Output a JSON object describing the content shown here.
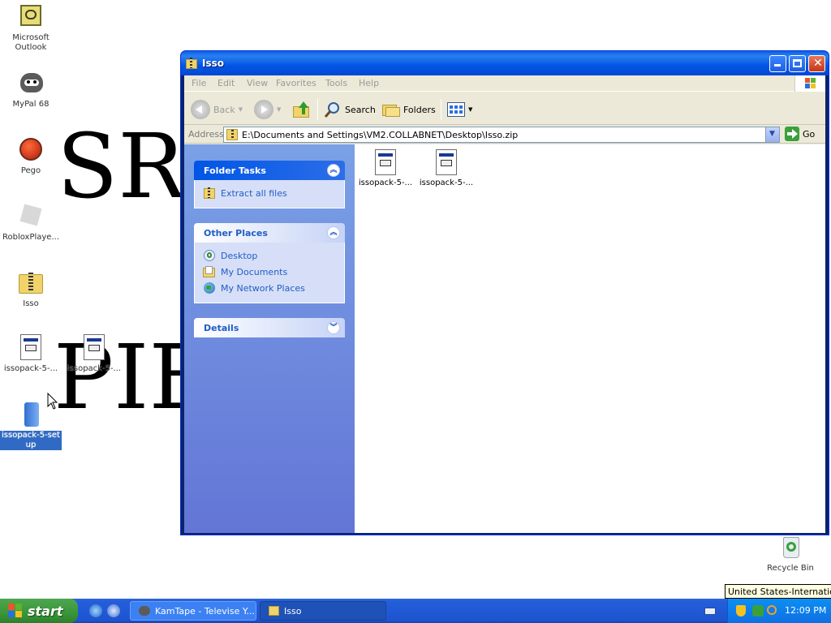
{
  "desktop": {
    "wallpaper_text_top": "SR",
    "wallpaper_text_bottom": "PIE",
    "icons": [
      {
        "label": "Microsoft Outlook",
        "icon": "outlook-icon"
      },
      {
        "label": "MyPal 68",
        "icon": "mypal-raccoon-icon"
      },
      {
        "label": "Pego",
        "icon": "pego-icon"
      },
      {
        "label": "RobloxPlaye...",
        "icon": "roblox-icon"
      },
      {
        "label": "Isso",
        "icon": "zip-folder-icon"
      },
      {
        "label": "issopack-5-...",
        "icon": "executable-icon"
      },
      {
        "label": "issopack-5-...",
        "icon": "executable-icon"
      },
      {
        "label": "issopack-5-set up",
        "icon": "setup-icon",
        "selected": true
      },
      {
        "label": "Recycle Bin",
        "icon": "recycle-bin-icon"
      }
    ]
  },
  "window": {
    "title": "Isso",
    "menu": [
      "File",
      "Edit",
      "View",
      "Favorites",
      "Tools",
      "Help"
    ],
    "toolbar": {
      "back": "Back",
      "search": "Search",
      "folders": "Folders"
    },
    "address": {
      "label": "Address",
      "path": "E:\\Documents and Settings\\VM2.COLLABNET\\Desktop\\Isso.zip",
      "go": "Go"
    },
    "task_pane": {
      "folder_tasks": {
        "title": "Folder Tasks",
        "items": [
          "Extract all files"
        ]
      },
      "other_places": {
        "title": "Other Places",
        "items": [
          "Desktop",
          "My Documents",
          "My Network Places"
        ]
      },
      "details": {
        "title": "Details"
      }
    },
    "files": [
      {
        "label": "issopack-5-..."
      },
      {
        "label": "issopack-5-..."
      }
    ]
  },
  "taskbar": {
    "start": "start",
    "buttons": [
      {
        "label": "KamTape - Televise Y...",
        "active": false
      },
      {
        "label": "Isso",
        "active": true
      }
    ],
    "clock": "12:09 PM",
    "tooltip": "United States-International"
  }
}
